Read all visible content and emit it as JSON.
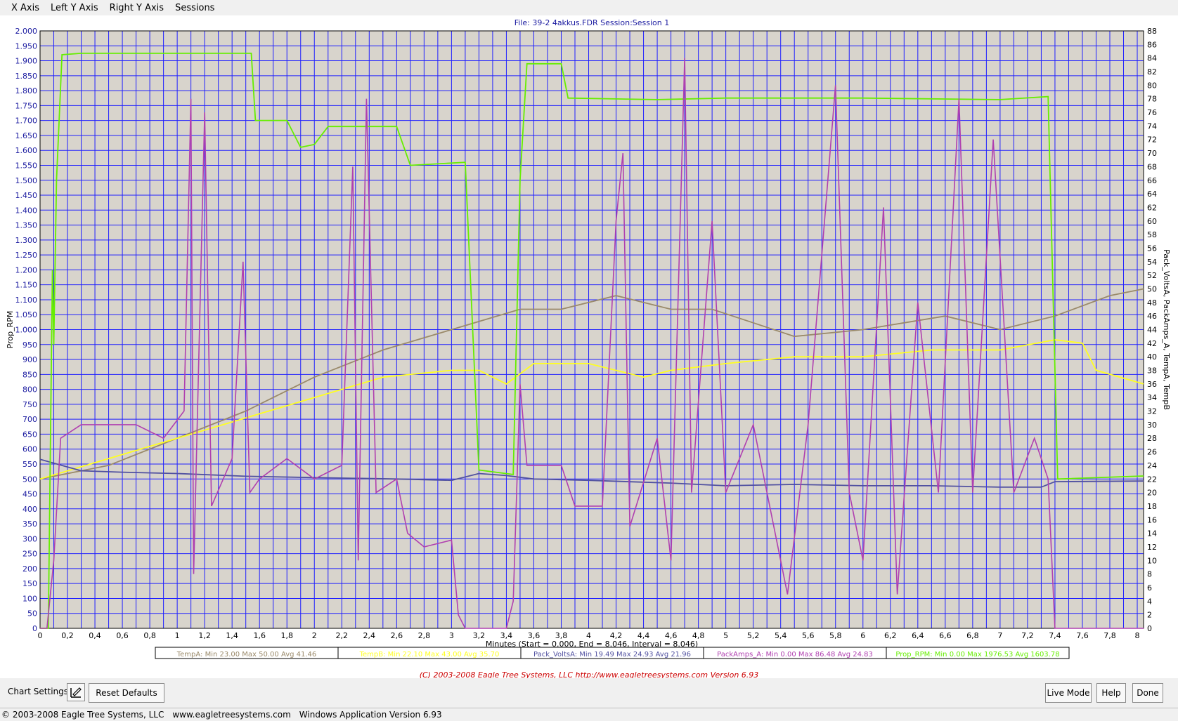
{
  "menu": {
    "items": [
      "X Axis",
      "Left Y Axis",
      "Right Y Axis",
      "Sessions"
    ]
  },
  "header": {
    "file_label": "File: 39-2 4akkus.FDR   Session:Session 1"
  },
  "colors": {
    "plot_bg": "#d8d4cc",
    "grid": "#2020ff",
    "rpm": "#66ee00",
    "amps": "#b040b0",
    "tempA": "#9a8a6a",
    "tempB": "#ffff20",
    "volts": "#5050a0",
    "axis_text": "#1a1aa0",
    "copyright": "#cc0000"
  },
  "legend": [
    {
      "name": "TempA",
      "text": "TempA:  Min 23.00   Max 50.00   Avg 41.46",
      "color": "#9a8a6a"
    },
    {
      "name": "TempB",
      "text": "TempB:  Min 22.10   Max 43.00   Avg 35.70",
      "color": "#ffff20"
    },
    {
      "name": "Pack_VoltsA",
      "text": "Pack_VoltsA:  Min 19.49   Max 24.93   Avg 21.96",
      "color": "#5050a0"
    },
    {
      "name": "PackAmps_A",
      "text": "PackAmps_A:  Min 0.00   Max 86.48   Avg 24.83",
      "color": "#b040b0"
    },
    {
      "name": "Prop_RPM",
      "text": "Prop_RPM:  Min 0.00   Max 1976.53   Avg 1603.78",
      "color": "#66ee00"
    }
  ],
  "copyright_line": "(C) 2003-2008 Eagle Tree Systems, LLC     http://www.eagletreesystems.com    Version 6.93",
  "controls": {
    "chart_settings_label": "Chart Settings:",
    "reset_defaults": "Reset Defaults",
    "live_mode": "Live Mode",
    "help": "Help",
    "done": "Done"
  },
  "status_bar": {
    "copyright": "© 2003-2008 Eagle Tree Systems, LLC",
    "website": "www.eagletreesystems.com",
    "version": "Windows Application Version 6.93"
  },
  "chart_data": {
    "type": "line",
    "xlabel": "Minutes (Start = 0.000,  End = 8.046,  Interval =  8.046)",
    "ylabel_left": "Prop_RPM",
    "ylabel_right": "Pack_VoltsA, PackAmps_A, TempA, TempB",
    "xlim": [
      0,
      8.046
    ],
    "ylim_left": [
      0,
      2000
    ],
    "ylim_right": [
      0,
      88
    ],
    "x_ticks": [
      "0",
      "0,2",
      "0,4",
      "0,6",
      "0,8",
      "1",
      "1,2",
      "1,4",
      "1,6",
      "1,8",
      "2",
      "2,2",
      "2,4",
      "2,6",
      "2,8",
      "3",
      "3,2",
      "3,4",
      "3,6",
      "3,8",
      "4",
      "4,2",
      "4,4",
      "4,6",
      "4,8",
      "5",
      "5,2",
      "5,4",
      "5,6",
      "5,8",
      "6",
      "6,2",
      "6,4",
      "6,6",
      "6,8",
      "7",
      "7,2",
      "7,4",
      "7,6",
      "7,8",
      "8"
    ],
    "y_left_ticks": [
      "0",
      "50",
      "100",
      "150",
      "200",
      "250",
      "300",
      "350",
      "400",
      "450",
      "500",
      "550",
      "600",
      "650",
      "700",
      "750",
      "800",
      "850",
      "900",
      "950",
      "1.000",
      "1.050",
      "1.100",
      "1.150",
      "1.200",
      "1.250",
      "1.300",
      "1.350",
      "1.400",
      "1.450",
      "1.500",
      "1.550",
      "1.600",
      "1.650",
      "1.700",
      "1.750",
      "1.800",
      "1.850",
      "1.900",
      "1.950",
      "2.000"
    ],
    "y_right_ticks": [
      "0",
      "2",
      "4",
      "6",
      "8",
      "10",
      "12",
      "14",
      "16",
      "18",
      "20",
      "22",
      "24",
      "26",
      "28",
      "30",
      "32",
      "34",
      "36",
      "38",
      "40",
      "42",
      "44",
      "46",
      "48",
      "50",
      "52",
      "54",
      "56",
      "58",
      "60",
      "62",
      "64",
      "66",
      "68",
      "70",
      "72",
      "74",
      "76",
      "78",
      "80",
      "82",
      "84",
      "86",
      "88"
    ],
    "series": [
      {
        "name": "Prop_RPM",
        "axis": "left",
        "color": "#66ee00",
        "points": [
          [
            0,
            0
          ],
          [
            0.06,
            0
          ],
          [
            0.09,
            1200
          ],
          [
            0.1,
            950
          ],
          [
            0.12,
            1500
          ],
          [
            0.16,
            1920
          ],
          [
            0.3,
            1925
          ],
          [
            1.0,
            1925
          ],
          [
            1.54,
            1925
          ],
          [
            1.57,
            1700
          ],
          [
            1.8,
            1700
          ],
          [
            1.9,
            1610
          ],
          [
            2.0,
            1620
          ],
          [
            2.1,
            1680
          ],
          [
            2.6,
            1680
          ],
          [
            2.7,
            1550
          ],
          [
            3.1,
            1560
          ],
          [
            3.2,
            530
          ],
          [
            3.45,
            515
          ],
          [
            3.5,
            1500
          ],
          [
            3.55,
            1890
          ],
          [
            3.8,
            1890
          ],
          [
            3.85,
            1775
          ],
          [
            4.5,
            1770
          ],
          [
            5.0,
            1775
          ],
          [
            6.0,
            1775
          ],
          [
            7.0,
            1770
          ],
          [
            7.35,
            1780
          ],
          [
            7.42,
            500
          ],
          [
            8.046,
            510
          ]
        ]
      },
      {
        "name": "PackAmps_A",
        "axis": "right",
        "points": [
          [
            0,
            0
          ],
          [
            0.05,
            0
          ],
          [
            0.1,
            10
          ],
          [
            0.15,
            28
          ],
          [
            0.3,
            30
          ],
          [
            0.5,
            30
          ],
          [
            0.7,
            30
          ],
          [
            0.9,
            28
          ],
          [
            1.05,
            32
          ],
          [
            1.1,
            78
          ],
          [
            1.12,
            8
          ],
          [
            1.2,
            76
          ],
          [
            1.25,
            18
          ],
          [
            1.4,
            25
          ],
          [
            1.48,
            54
          ],
          [
            1.53,
            20
          ],
          [
            1.6,
            22
          ],
          [
            1.8,
            25
          ],
          [
            2.0,
            22
          ],
          [
            2.2,
            24
          ],
          [
            2.28,
            68
          ],
          [
            2.32,
            10
          ],
          [
            2.38,
            78
          ],
          [
            2.45,
            20
          ],
          [
            2.6,
            22
          ],
          [
            2.68,
            14
          ],
          [
            2.8,
            12
          ],
          [
            3.0,
            13
          ],
          [
            3.05,
            2
          ],
          [
            3.1,
            0
          ],
          [
            3.4,
            0
          ],
          [
            3.45,
            4
          ],
          [
            3.5,
            36
          ],
          [
            3.55,
            24
          ],
          [
            3.8,
            24
          ],
          [
            3.9,
            18
          ],
          [
            4.1,
            18
          ],
          [
            4.2,
            60
          ],
          [
            4.25,
            70
          ],
          [
            4.3,
            15
          ],
          [
            4.5,
            28
          ],
          [
            4.6,
            10
          ],
          [
            4.7,
            84
          ],
          [
            4.75,
            20
          ],
          [
            4.9,
            60
          ],
          [
            5.0,
            20
          ],
          [
            5.2,
            30
          ],
          [
            5.3,
            20
          ],
          [
            5.45,
            5
          ],
          [
            5.6,
            30
          ],
          [
            5.8,
            80
          ],
          [
            5.9,
            20
          ],
          [
            6.0,
            10
          ],
          [
            6.15,
            62
          ],
          [
            6.25,
            5
          ],
          [
            6.4,
            48
          ],
          [
            6.55,
            20
          ],
          [
            6.7,
            78
          ],
          [
            6.8,
            20
          ],
          [
            6.95,
            72
          ],
          [
            7.1,
            20
          ],
          [
            7.25,
            28
          ],
          [
            7.35,
            22
          ],
          [
            7.4,
            0
          ],
          [
            8.046,
            0
          ]
        ]
      },
      {
        "name": "TempA",
        "axis": "right",
        "points": [
          [
            0,
            22
          ],
          [
            0.5,
            24
          ],
          [
            1.0,
            28
          ],
          [
            1.5,
            32
          ],
          [
            2.0,
            37
          ],
          [
            2.5,
            41
          ],
          [
            3.0,
            44
          ],
          [
            3.5,
            47
          ],
          [
            3.8,
            47
          ],
          [
            4.2,
            49
          ],
          [
            4.6,
            47
          ],
          [
            4.9,
            47
          ],
          [
            5.2,
            45
          ],
          [
            5.5,
            43
          ],
          [
            6.0,
            44
          ],
          [
            6.3,
            45
          ],
          [
            6.6,
            46
          ],
          [
            7.0,
            44
          ],
          [
            7.4,
            46
          ],
          [
            7.8,
            49
          ],
          [
            8.046,
            50
          ]
        ]
      },
      {
        "name": "TempB",
        "axis": "right",
        "points": [
          [
            0,
            22
          ],
          [
            0.5,
            25
          ],
          [
            1.0,
            28
          ],
          [
            1.5,
            31
          ],
          [
            2.0,
            34
          ],
          [
            2.5,
            37
          ],
          [
            3.0,
            38
          ],
          [
            3.2,
            38
          ],
          [
            3.4,
            36
          ],
          [
            3.6,
            39
          ],
          [
            4.0,
            39
          ],
          [
            4.4,
            37
          ],
          [
            4.6,
            38
          ],
          [
            5.0,
            39
          ],
          [
            5.5,
            40
          ],
          [
            6.0,
            40
          ],
          [
            6.5,
            41
          ],
          [
            7.0,
            41
          ],
          [
            7.4,
            42.5
          ],
          [
            7.6,
            42
          ],
          [
            7.7,
            38
          ],
          [
            8.046,
            36
          ]
        ]
      },
      {
        "name": "Pack_VoltsA",
        "axis": "right",
        "points": [
          [
            0,
            24.9
          ],
          [
            0.3,
            23.2
          ],
          [
            0.6,
            23
          ],
          [
            1.0,
            22.8
          ],
          [
            1.5,
            22.4
          ],
          [
            2.0,
            22.2
          ],
          [
            2.6,
            22
          ],
          [
            3.0,
            21.8
          ],
          [
            3.2,
            22.8
          ],
          [
            3.4,
            22.5
          ],
          [
            3.6,
            22
          ],
          [
            4.0,
            21.8
          ],
          [
            4.6,
            21.4
          ],
          [
            5.0,
            21
          ],
          [
            5.5,
            21.2
          ],
          [
            6.0,
            21
          ],
          [
            6.5,
            21
          ],
          [
            7.0,
            20.8
          ],
          [
            7.3,
            20.8
          ],
          [
            7.4,
            21.6
          ],
          [
            8.046,
            21.7
          ]
        ]
      }
    ]
  }
}
